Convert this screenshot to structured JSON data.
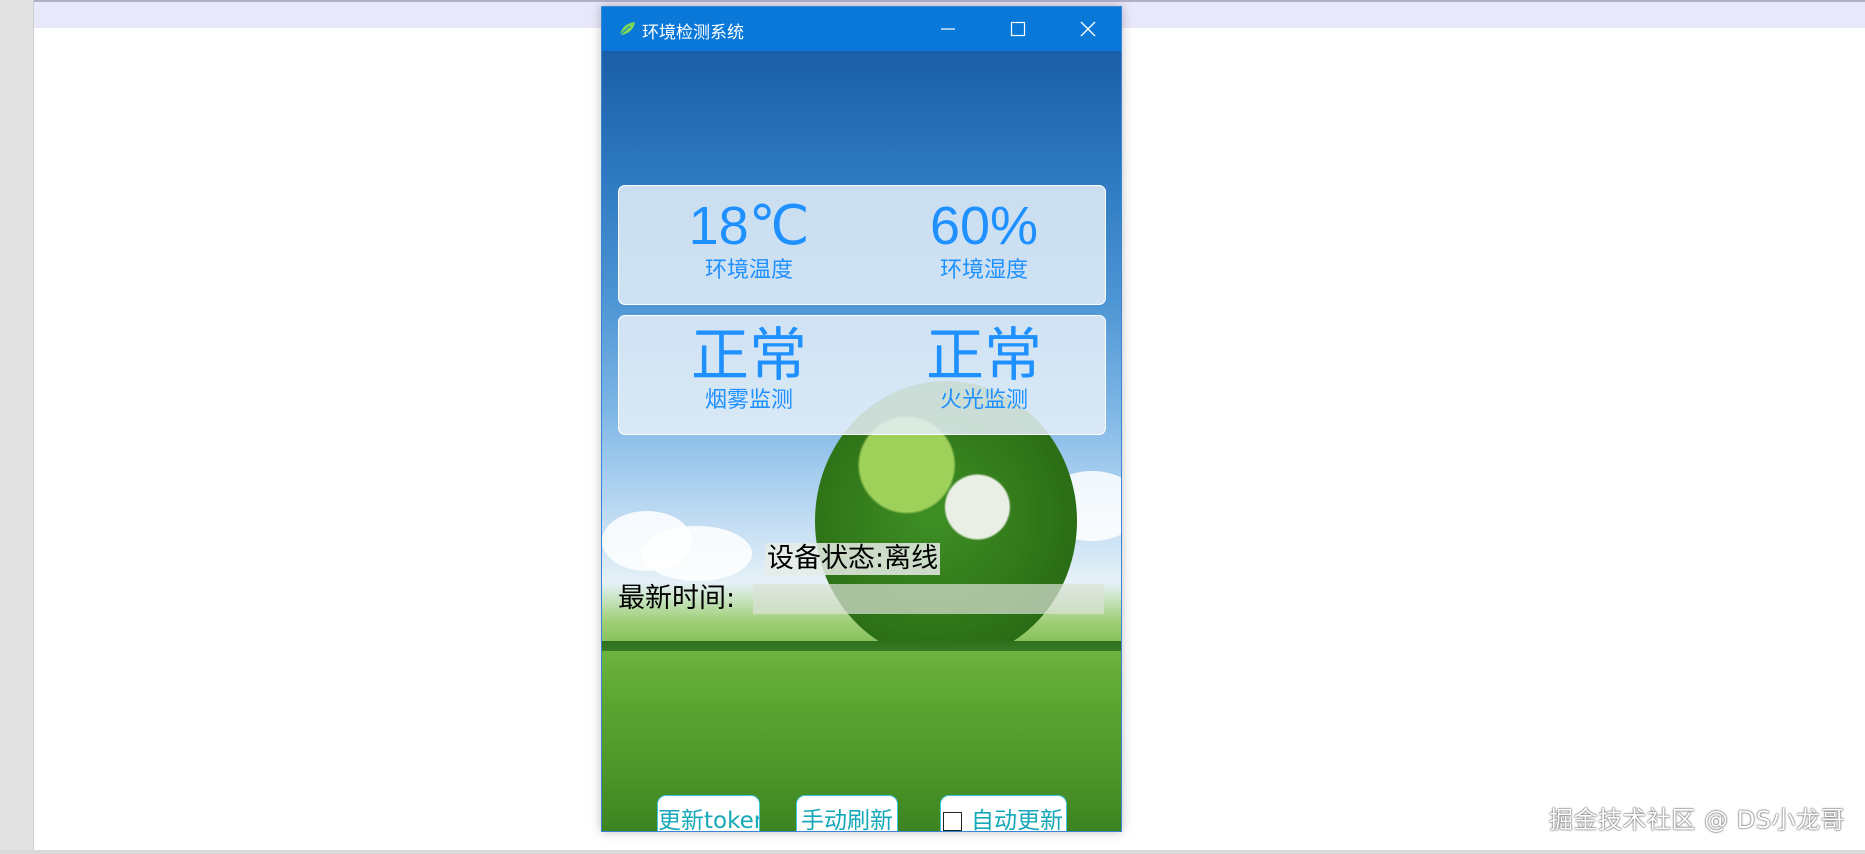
{
  "window": {
    "title": "环境检测系统"
  },
  "metrics": {
    "temperature": {
      "value": "18℃",
      "label": "环境温度"
    },
    "humidity": {
      "value": "60%",
      "label": "环境湿度"
    },
    "smoke": {
      "value": "正常",
      "label": "烟雾监测"
    },
    "fire": {
      "value": "正常",
      "label": "火光监测"
    }
  },
  "status": {
    "device_text": "设备状态:离线",
    "time_label": "最新时间:",
    "time_value": ""
  },
  "buttons": {
    "update_token": "更新token",
    "manual_refresh": "手动刷新",
    "auto_update": "自动更新",
    "auto_update_checked": false
  },
  "watermark": "掘金技术社区 @ DS小龙哥",
  "colors": {
    "titlebar": "#0a78d8",
    "metric_text": "#1e90ff",
    "button_text": "#14a8b8",
    "button_border": "#41c4e0"
  },
  "icons": {
    "title": "leaf-icon",
    "minimize": "minimize-icon",
    "maximize": "maximize-icon",
    "close": "close-icon"
  }
}
